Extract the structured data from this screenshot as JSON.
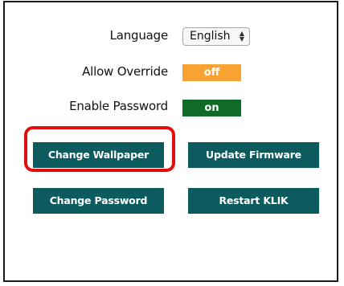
{
  "settings": {
    "language": {
      "label": "Language",
      "selected": "English"
    },
    "allow_override": {
      "label": "Allow Override",
      "state": "off",
      "color": "#f7a233"
    },
    "enable_password": {
      "label": "Enable Password",
      "state": "on",
      "color": "#116b28"
    }
  },
  "buttons": {
    "change_wallpaper": "Change Wallpaper",
    "update_firmware": "Update Firmware",
    "change_password": "Change Password",
    "restart": "Restart KLIK"
  },
  "colors": {
    "button_bg": "#0c5b5f",
    "highlight": "#e01010"
  },
  "icons": {
    "select_arrows": "up-down-chevron-icon"
  }
}
